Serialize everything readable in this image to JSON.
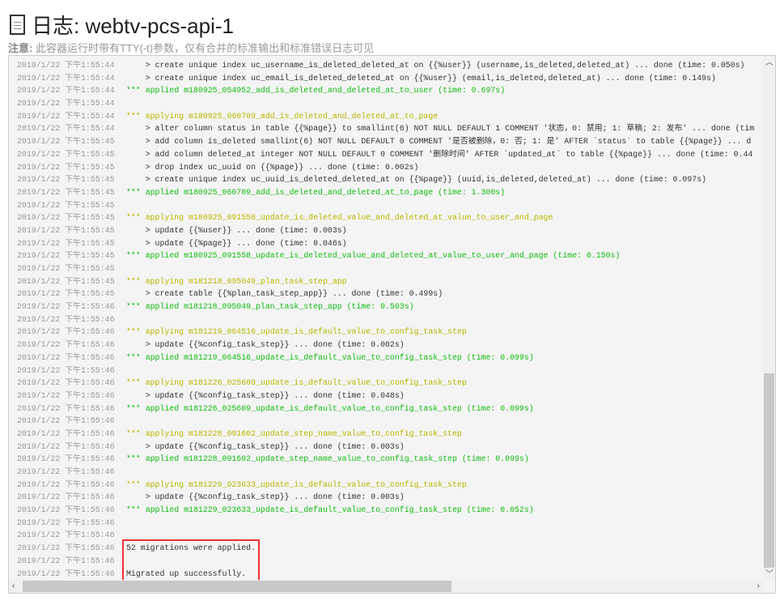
{
  "header": {
    "title": "日志: webtv-pcs-api-1",
    "note_label": "注意:",
    "note_text": " 此容器运行时带有TTY(-t)参数，仅有合并的标准输出和标准错误日志可见"
  },
  "colors": {
    "applying": "#b8b800",
    "applied": "#11bb11",
    "highlight": "#f03333"
  },
  "log": [
    {
      "t": "2019/1/22 下午1:55:44",
      "m": "    > create unique index uc_username_is_deleted_deleted_at on {{%user}} (username,is_deleted,deleted_at) ... done (time: 0.050s)",
      "k": "plain"
    },
    {
      "t": "2019/1/22 下午1:55:44",
      "m": "    > create unique index uc_email_is_deleted_deleted_at on {{%user}} (email,is_deleted,deleted_at) ... done (time: 0.149s)",
      "k": "plain"
    },
    {
      "t": "2019/1/22 下午1:55:44",
      "m": "*** applied m180925_054952_add_is_deleted_and_deleted_at_to_user (time: 0.697s)",
      "k": "applied"
    },
    {
      "t": "2019/1/22 下午1:55:44",
      "m": "",
      "k": "plain"
    },
    {
      "t": "2019/1/22 下午1:55:44",
      "m": "*** applying m180925_060709_add_is_deleted_and_deleted_at_to_page",
      "k": "applying"
    },
    {
      "t": "2019/1/22 下午1:55:44",
      "m": "    > alter column status in table {{%page}} to smallint(6) NOT NULL DEFAULT 1 COMMENT '状态，0: 禁用; 1: 草稿; 2: 发布' ... done (tim",
      "k": "plain"
    },
    {
      "t": "2019/1/22 下午1:55:45",
      "m": "    > add column is_deleted smallint(6) NOT NULL DEFAULT 0 COMMENT '是否被删除，0: 否; 1: 是' AFTER `status` to table {{%page}} ... d",
      "k": "plain"
    },
    {
      "t": "2019/1/22 下午1:55:45",
      "m": "    > add column deleted_at integer NOT NULL DEFAULT 0 COMMENT '删除时间' AFTER `updated_at` to table {{%page}} ... done (time: 0.44",
      "k": "plain"
    },
    {
      "t": "2019/1/22 下午1:55:45",
      "m": "    > drop index uc_uuid on {{%page}} ... done (time: 0.002s)",
      "k": "plain"
    },
    {
      "t": "2019/1/22 下午1:55:45",
      "m": "    > create unique index uc_uuid_is_deleted_deleted_at on {{%page}} (uuid,is_deleted,deleted_at) ... done (time: 0.097s)",
      "k": "plain"
    },
    {
      "t": "2019/1/22 下午1:55:45",
      "m": "*** applied m180925_060709_add_is_deleted_and_deleted_at_to_page (time: 1.300s)",
      "k": "applied"
    },
    {
      "t": "2019/1/22 下午1:55:45",
      "m": "",
      "k": "plain"
    },
    {
      "t": "2019/1/22 下午1:55:45",
      "m": "*** applying m180925_091558_update_is_deleted_value_and_deleted_at_value_to_user_and_page",
      "k": "applying"
    },
    {
      "t": "2019/1/22 下午1:55:45",
      "m": "    > update {{%user}} ... done (time: 0.003s)",
      "k": "plain"
    },
    {
      "t": "2019/1/22 下午1:55:45",
      "m": "    > update {{%page}} ... done (time: 0.046s)",
      "k": "plain"
    },
    {
      "t": "2019/1/22 下午1:55:45",
      "m": "*** applied m180925_091558_update_is_deleted_value_and_deleted_at_value_to_user_and_page (time: 0.150s)",
      "k": "applied"
    },
    {
      "t": "2019/1/22 下午1:55:45",
      "m": "",
      "k": "plain"
    },
    {
      "t": "2019/1/22 下午1:55:45",
      "m": "*** applying m181218_095049_plan_task_step_app",
      "k": "applying"
    },
    {
      "t": "2019/1/22 下午1:55:45",
      "m": "    > create table {{%plan_task_step_app}} ... done (time: 0.499s)",
      "k": "plain"
    },
    {
      "t": "2019/1/22 下午1:55:46",
      "m": "*** applied m181218_095049_plan_task_step_app (time: 0.503s)",
      "k": "applied"
    },
    {
      "t": "2019/1/22 下午1:55:46",
      "m": "",
      "k": "plain"
    },
    {
      "t": "2019/1/22 下午1:55:46",
      "m": "*** applying m181219_064516_update_is_default_value_to_config_task_step",
      "k": "applying"
    },
    {
      "t": "2019/1/22 下午1:55:46",
      "m": "    > update {{%config_task_step}} ... done (time: 0.002s)",
      "k": "plain"
    },
    {
      "t": "2019/1/22 下午1:55:46",
      "m": "*** applied m181219_064516_update_is_default_value_to_config_task_step (time: 0.099s)",
      "k": "applied"
    },
    {
      "t": "2019/1/22 下午1:55:46",
      "m": "",
      "k": "plain"
    },
    {
      "t": "2019/1/22 下午1:55:46",
      "m": "*** applying m181226_025609_update_is_default_value_to_config_task_step",
      "k": "applying"
    },
    {
      "t": "2019/1/22 下午1:55:46",
      "m": "    > update {{%config_task_step}} ... done (time: 0.048s)",
      "k": "plain"
    },
    {
      "t": "2019/1/22 下午1:55:46",
      "m": "*** applied m181226_025609_update_is_default_value_to_config_task_step (time: 0.099s)",
      "k": "applied"
    },
    {
      "t": "2019/1/22 下午1:55:46",
      "m": "",
      "k": "plain"
    },
    {
      "t": "2019/1/22 下午1:55:46",
      "m": "*** applying m181228_091602_update_step_name_value_to_config_task_step",
      "k": "applying"
    },
    {
      "t": "2019/1/22 下午1:55:46",
      "m": "    > update {{%config_task_step}} ... done (time: 0.003s)",
      "k": "plain"
    },
    {
      "t": "2019/1/22 下午1:55:46",
      "m": "*** applied m181228_091602_update_step_name_value_to_config_task_step (time: 0.099s)",
      "k": "applied"
    },
    {
      "t": "2019/1/22 下午1:55:46",
      "m": "",
      "k": "plain"
    },
    {
      "t": "2019/1/22 下午1:55:46",
      "m": "*** applying m181229_023633_update_is_default_value_to_config_task_step",
      "k": "applying"
    },
    {
      "t": "2019/1/22 下午1:55:46",
      "m": "    > update {{%config_task_step}} ... done (time: 0.003s)",
      "k": "plain"
    },
    {
      "t": "2019/1/22 下午1:55:46",
      "m": "*** applied m181229_023633_update_is_default_value_to_config_task_step (time: 0.052s)",
      "k": "applied"
    },
    {
      "t": "2019/1/22 下午1:55:46",
      "m": "",
      "k": "plain"
    },
    {
      "t": "2019/1/22 下午1:55:46",
      "m": "",
      "k": "plain"
    },
    {
      "t": "2019/1/22 下午1:55:46",
      "m": "52 migrations were applied.",
      "k": "plain"
    },
    {
      "t": "2019/1/22 下午1:55:46",
      "m": "",
      "k": "plain"
    },
    {
      "t": "2019/1/22 下午1:55:46",
      "m": "Migrated up successfully.",
      "k": "plain"
    }
  ],
  "scroll": {
    "vertical_position_fraction": 0.9,
    "horizontal_position_fraction": 0
  }
}
